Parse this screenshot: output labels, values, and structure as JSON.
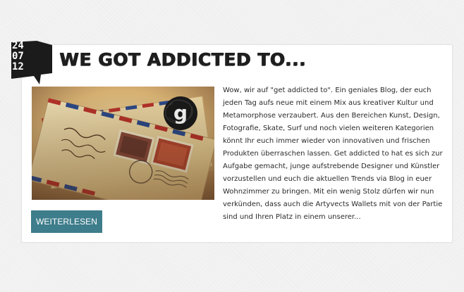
{
  "post": {
    "date": {
      "day": "24",
      "month": "07",
      "year": "12"
    },
    "title": "WE GOT ADDICTED TO...",
    "excerpt": "Wow, wir auf \"get addicted to\". Ein geniales Blog, der euch jeden Tag aufs neue mit einem Mix aus kreativer Kultur und Metamorphose verzaubert. Aus den Bereichen Kunst, Design, Fotografie, Skate, Surf und noch vielen weiteren Kategorien könnt Ihr euch immer wieder von innovativen und frischen Produkten überraschen lassen. Get addicted to hat es sich zur Aufgabe gemacht, junge aufstrebende Designer und Künstler vorzustellen und euch die aktuellen Trends via Blog in euer Wohnzimmer zu bringen. Mit ein wenig Stolz dürfen wir nun verkünden, dass auch die Artyvects Wallets mit von der Partie sind und Ihren Platz in einem unserer...",
    "read_more_label": "WEITERLESEN",
    "image": {
      "logo_letter": "g"
    }
  },
  "colors": {
    "button": "#3e7d8b",
    "badge": "#1b1b1b",
    "title": "#1e1e1e"
  }
}
